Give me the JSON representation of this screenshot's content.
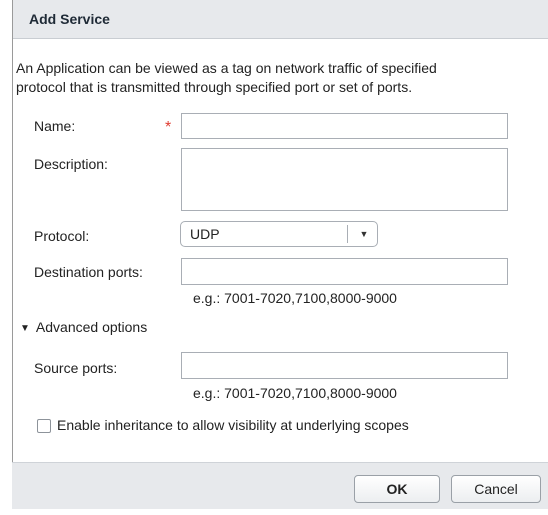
{
  "dialog": {
    "title": "Add Service",
    "description_line1": "An Application can be viewed as a tag on network traffic of specified",
    "description_line2": "protocol that is transmitted through specified port or set of ports."
  },
  "form": {
    "name_label": "Name:",
    "required_marker": "*",
    "name_value": "",
    "description_label": "Description:",
    "description_value": "",
    "protocol_label": "Protocol:",
    "protocol_value": "UDP",
    "protocol_arrow": "▼",
    "destination_ports_label": "Destination ports:",
    "destination_ports_value": "",
    "destination_ports_hint": "e.g.: 7001-7020,7100,8000-9000",
    "advanced_toggle_label": "Advanced options",
    "advanced_toggle_icon": "▼",
    "source_ports_label": "Source ports:",
    "source_ports_value": "",
    "source_ports_hint": "e.g.: 7001-7020,7100,8000-9000",
    "inheritance_checked": false,
    "inheritance_label": "Enable inheritance to allow visibility at underlying scopes"
  },
  "footer": {
    "ok_label": "OK",
    "cancel_label": "Cancel"
  },
  "colors": {
    "title_bar": "#e7e9ec",
    "required": "#e03c31",
    "footer": "#e7e9ec"
  }
}
